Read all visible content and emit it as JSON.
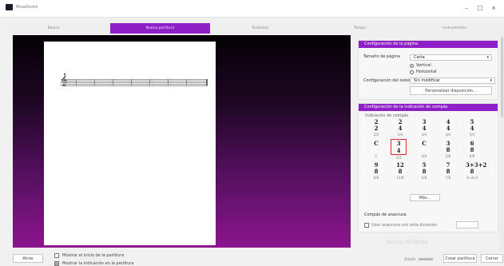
{
  "window": {
    "title": "MuseScore",
    "minimize_glyph": "–",
    "maximize_glyph": "□",
    "close_glyph": "×"
  },
  "tabs": [
    {
      "label": "Básico"
    },
    {
      "label": "Nueva partitura"
    },
    {
      "label": "Tonalidad"
    },
    {
      "label": "Tempo"
    },
    {
      "label": "Instrumentos"
    }
  ],
  "page_setup": {
    "header": "Configuración de la página",
    "size_label": "Tamaño de página",
    "size_value": "Carta",
    "orientation_vertical": "Vertical",
    "orientation_horizontal": "Horizontal",
    "staff_label": "Configuración del sistema",
    "staff_value": "Sin modificar",
    "customize_button": "Personalizar disposición..."
  },
  "time_signature": {
    "header": "Configuración de la indicación de compás",
    "subtitle": "Indicación de compás",
    "items": [
      {
        "top": "2",
        "bottom": "2",
        "caption": "2/2"
      },
      {
        "top": "2",
        "bottom": "4",
        "caption": "2/4"
      },
      {
        "top": "3",
        "bottom": "4",
        "caption": "3/4"
      },
      {
        "top": "4",
        "bottom": "4",
        "caption": "4/4"
      },
      {
        "top": "5",
        "bottom": "4",
        "caption": "5/4"
      },
      {
        "top": "C",
        "bottom": "",
        "caption": "C"
      },
      {
        "top": "3",
        "bottom": "4",
        "caption": "3/4"
      },
      {
        "top": "C",
        "bottom": "",
        "caption": "4/4"
      },
      {
        "top": "3",
        "bottom": "8",
        "caption": "3/8"
      },
      {
        "top": "6",
        "bottom": "8",
        "caption": "6/8"
      },
      {
        "top": "9",
        "bottom": "8",
        "caption": "9/8"
      },
      {
        "top": "12",
        "bottom": "8",
        "caption": "12/8"
      },
      {
        "top": "5",
        "bottom": "8",
        "caption": "5/8"
      },
      {
        "top": "7",
        "bottom": "8",
        "caption": "7/8"
      },
      {
        "top": "3+3+2",
        "bottom": "8",
        "caption": "3+3+2"
      }
    ],
    "more_button": "Más...",
    "anacrusis_label": "Compás de anacrusa",
    "anacrusis_checkbox": "Usar anacrusa con esta duración"
  },
  "bottom": {
    "back_button": "Atrás",
    "checkbox1": "Mostrar el inicio de la partitura",
    "checkbox2": "Mostrar la indicación en la partitura",
    "zoom_label": "Zoom",
    "finish_button": "Crear partitura",
    "cancel_button": "Cerrar",
    "watermark": "Activar Windows"
  },
  "colors": {
    "accent": "#8f1fc6",
    "selected_outline": "#e5262f"
  }
}
